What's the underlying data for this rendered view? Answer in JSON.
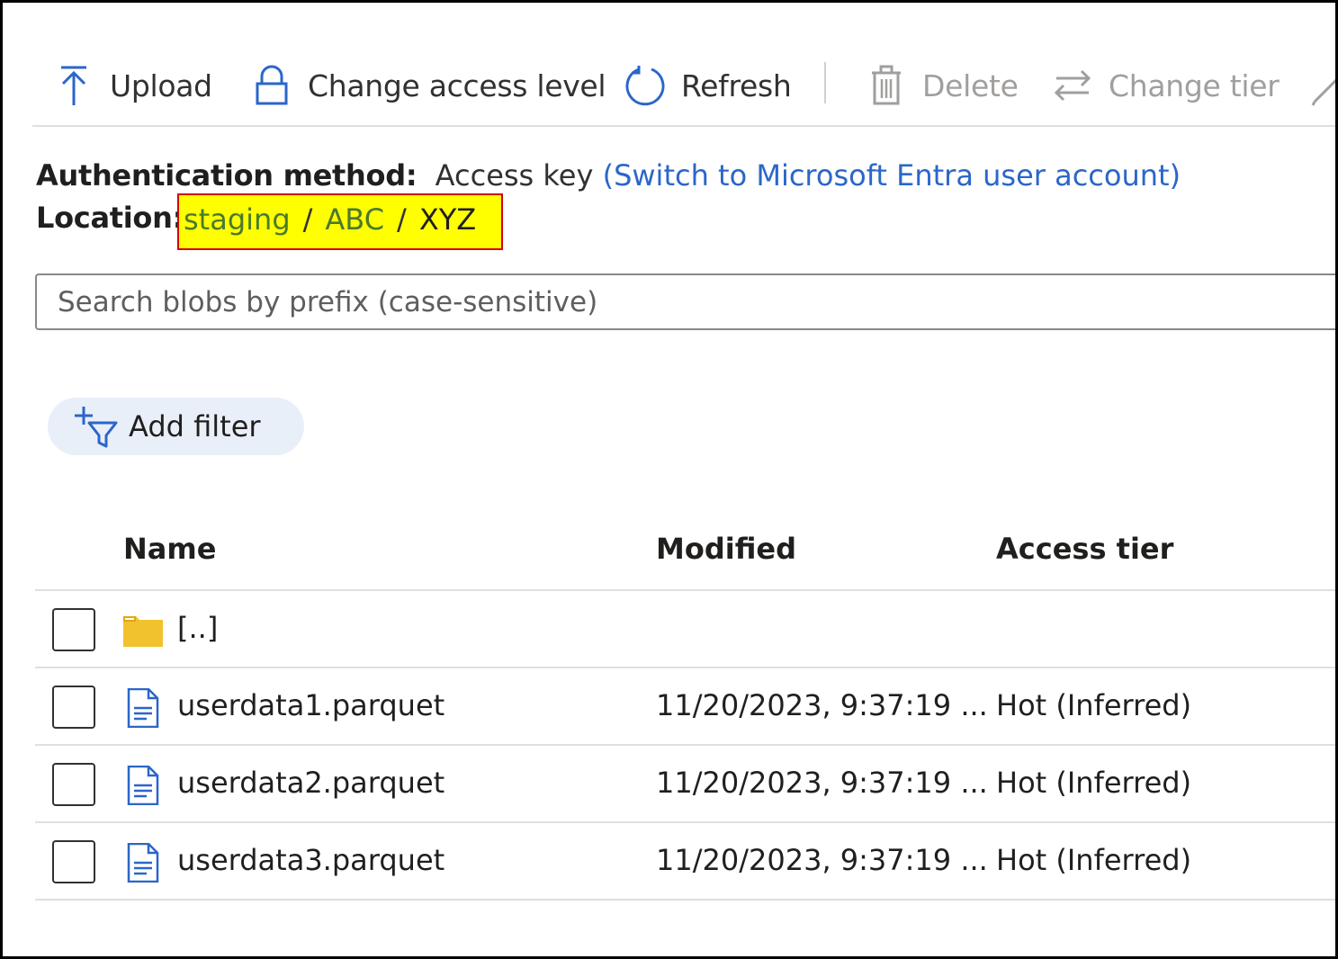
{
  "toolbar": {
    "upload": "Upload",
    "change_access": "Change access level",
    "refresh": "Refresh",
    "delete": "Delete",
    "change_tier": "Change tier"
  },
  "auth": {
    "label": "Authentication method:",
    "value": "Access key",
    "link": "(Switch to Microsoft Entra user account)"
  },
  "location": {
    "label": "Location:",
    "crumbs": [
      "staging",
      "ABC",
      "XYZ"
    ]
  },
  "search": {
    "placeholder": "Search blobs by prefix (case-sensitive)"
  },
  "filter": {
    "label": "Add filter"
  },
  "table": {
    "headers": {
      "name": "Name",
      "modified": "Modified",
      "tier": "Access tier"
    },
    "rows": [
      {
        "name": "[..]",
        "type": "folder",
        "modified": "",
        "tier": ""
      },
      {
        "name": "userdata1.parquet",
        "type": "file",
        "modified": "11/20/2023, 9:37:19 ...",
        "tier": "Hot (Inferred)"
      },
      {
        "name": "userdata2.parquet",
        "type": "file",
        "modified": "11/20/2023, 9:37:19 ...",
        "tier": "Hot (Inferred)"
      },
      {
        "name": "userdata3.parquet",
        "type": "file",
        "modified": "11/20/2023, 9:37:19 ...",
        "tier": "Hot (Inferred)"
      }
    ]
  },
  "colors": {
    "accent": "#2b66c9",
    "highlight": "#ffff00",
    "highlight_border": "#d40000",
    "folder": "#f2c12e"
  }
}
